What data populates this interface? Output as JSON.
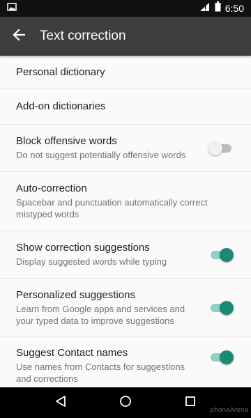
{
  "status_bar": {
    "time": "6:50",
    "icons": [
      "image-notification-icon",
      "signal-icon",
      "battery-icon"
    ]
  },
  "toolbar": {
    "back_icon": "arrow-back-icon",
    "title": "Text correction",
    "background": "#3d3d3d"
  },
  "settings": [
    {
      "title": "Personal dictionary",
      "summary": "",
      "toggle": null
    },
    {
      "title": "Add-on dictionaries",
      "summary": "",
      "toggle": null
    },
    {
      "title": "Block offensive words",
      "summary": "Do not suggest potentially offensive words",
      "toggle": "off"
    },
    {
      "title": "Auto-correction",
      "summary": "Spacebar and punctuation automatically correct mistyped words",
      "toggle": null
    },
    {
      "title": "Show correction suggestions",
      "summary": "Display suggested words while typing",
      "toggle": "on"
    },
    {
      "title": "Personalized suggestions",
      "summary": "Learn from Google apps and services and your typed data to improve suggestions",
      "toggle": "on"
    },
    {
      "title": "Suggest Contact names",
      "summary": "Use names from Contacts for suggestions and corrections",
      "toggle": "on"
    }
  ],
  "accent_color": "#1b8a74",
  "nav_bar": {
    "buttons": [
      "back-triangle-icon",
      "home-circle-icon",
      "recents-square-icon"
    ],
    "watermark": "phoneArena"
  }
}
